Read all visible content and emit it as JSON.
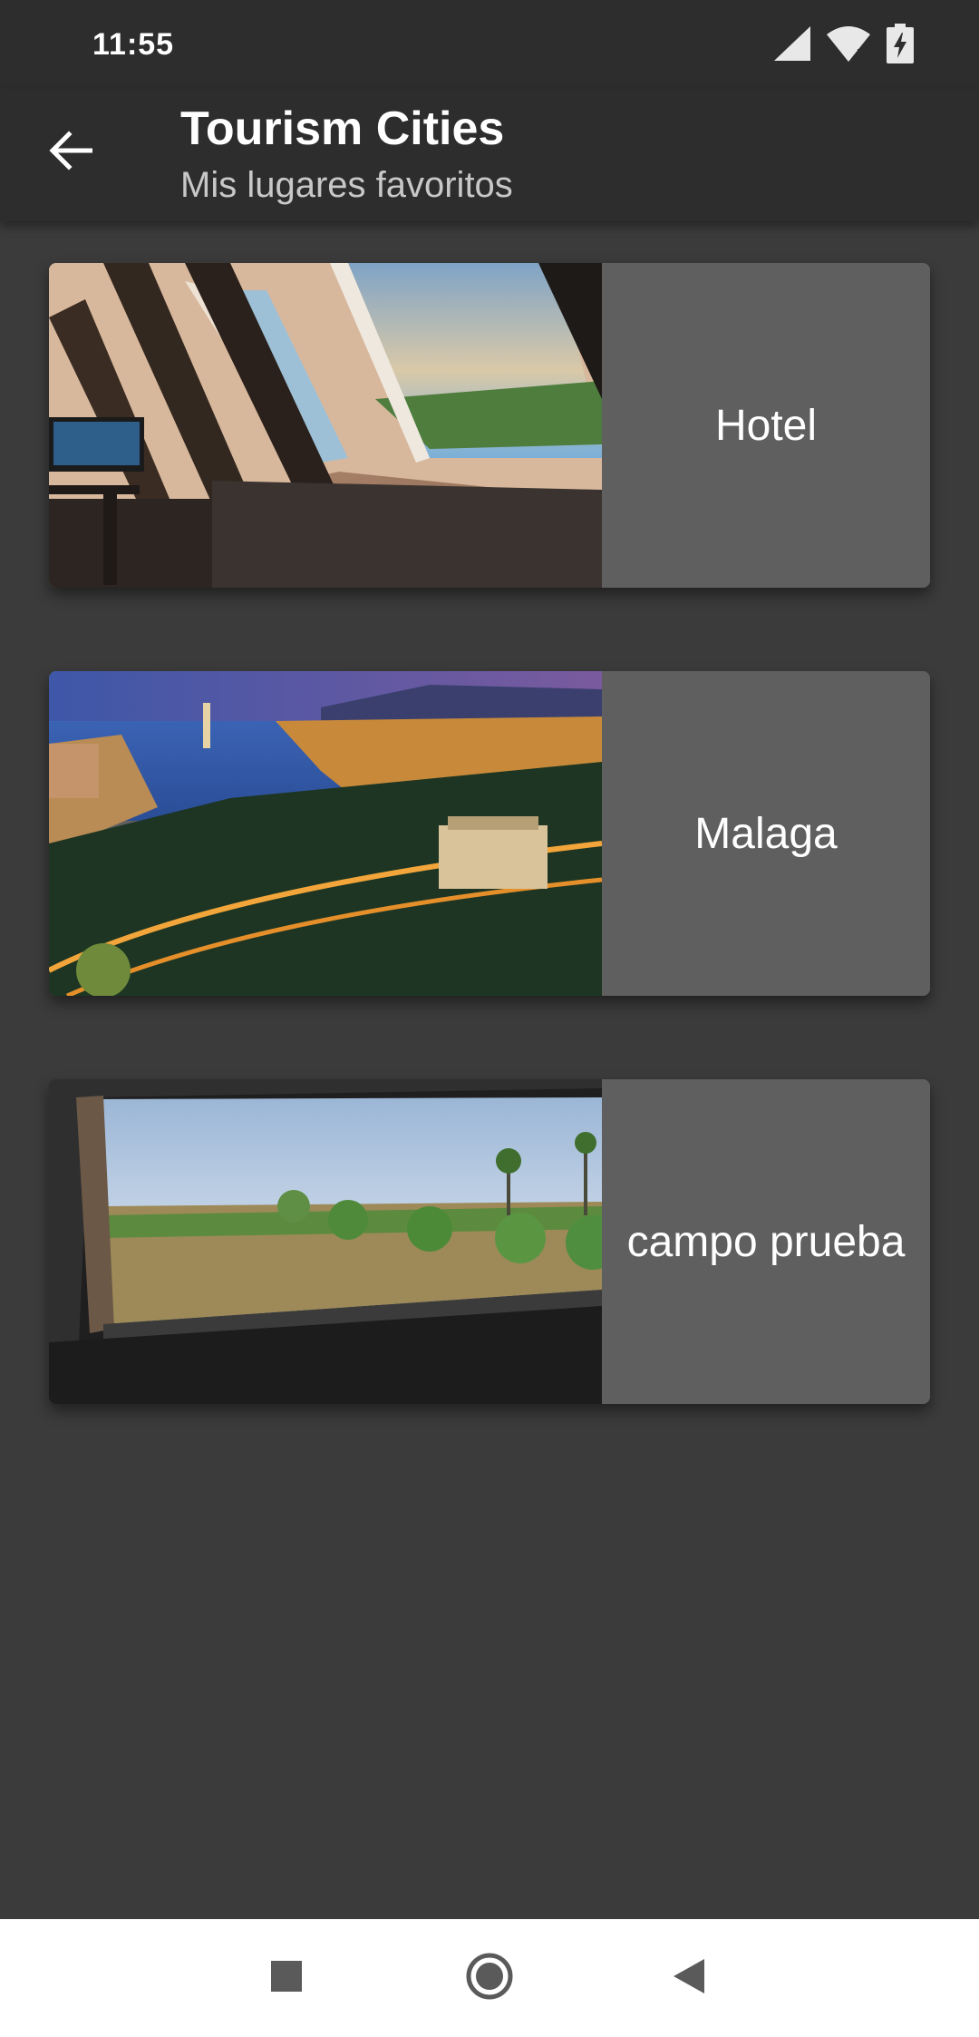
{
  "status_bar": {
    "time": "11:55",
    "icons": [
      "signal-icon",
      "wifi-icon",
      "battery-charging-icon"
    ]
  },
  "app_bar": {
    "title": "Tourism Cities",
    "subtitle": "Mis lugares favoritos",
    "back_icon": "arrow-back-icon"
  },
  "places": [
    {
      "name": "Hotel",
      "image": "attic-room-skylight-photo"
    },
    {
      "name": "Malaga",
      "image": "malaga-city-night-photo"
    },
    {
      "name": "campo prueba",
      "image": "field-through-window-photo"
    }
  ],
  "nav_bar": {
    "buttons": [
      "recents-square-icon",
      "home-circle-icon",
      "back-triangle-icon"
    ]
  },
  "colors": {
    "background": "#3b3b3b",
    "app_bar": "#2d2d2d",
    "card_label_bg": "#5f5f5f",
    "nav_bar": "#ffffff"
  }
}
